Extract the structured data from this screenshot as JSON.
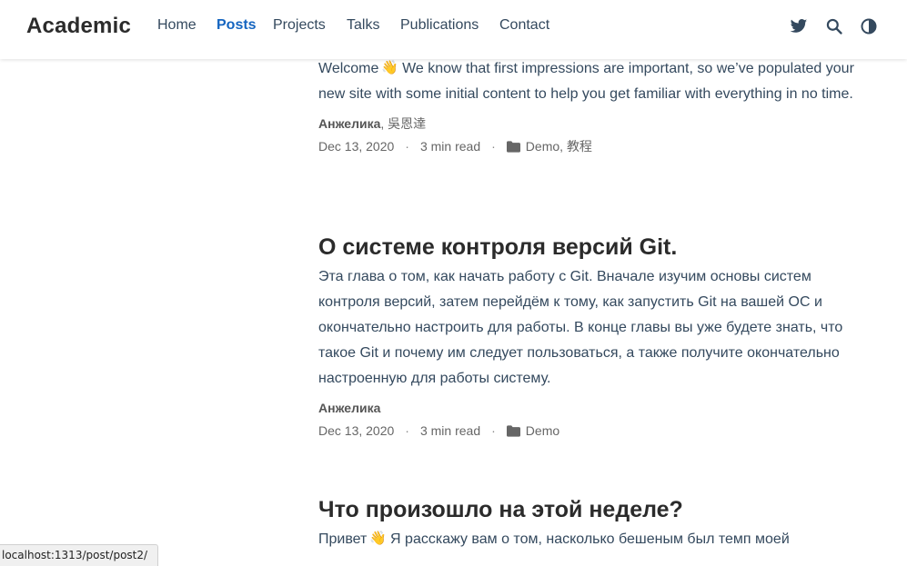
{
  "nav": {
    "brand": "Academic",
    "links": [
      {
        "label": "Home",
        "active": false
      },
      {
        "label": "Posts",
        "active": true
      },
      {
        "label": "Projects",
        "active": false
      },
      {
        "label": "Talks",
        "active": false
      },
      {
        "label": "Publications",
        "active": false
      },
      {
        "label": "Contact",
        "active": false
      }
    ],
    "icons": [
      "twitter-icon",
      "search-icon",
      "dark-mode-icon"
    ]
  },
  "posts": [
    {
      "title": "",
      "summary_before": "Welcome",
      "summary_after": "We know that first impressions are important, so we’ve populated your new site with some initial content to help you get familiar with everything in no time.",
      "authors": [
        {
          "name": "Анжелика",
          "strong": true
        },
        {
          "name": "吳恩達",
          "strong": false
        }
      ],
      "date": "Dec 13, 2020",
      "read_time": "3 min read",
      "categories": [
        "Demo",
        "教程"
      ]
    },
    {
      "title": "О системе контроля версий Git.",
      "summary": "Эта глава о том, как начать работу с Git. Вначале изучим основы систем контроля версий, затем перейдём к тому, как запустить Git на вашей ОС и окончательно настроить для работы. В конце главы вы уже будете знать, что такое Git и почему им следует пользоваться, а также получите окончательно настроенную для работы систему.",
      "authors": [
        {
          "name": "Анжелика",
          "strong": true
        }
      ],
      "date": "Dec 13, 2020",
      "read_time": "3 min read",
      "categories": [
        "Demo"
      ]
    },
    {
      "title": "Что произошло на этой неделе?",
      "summary_before": "Привет",
      "summary_after": "Я расскажу вам о том, насколько бешеным был темп моей"
    }
  ],
  "wave_emoji": "👋",
  "meta_separator": "·",
  "status_url": "localhost:1313/post/post2/",
  "colors": {
    "accent": "#1565c0",
    "text": "#34495e",
    "title": "#2b2b2b",
    "muted": "#666666"
  }
}
